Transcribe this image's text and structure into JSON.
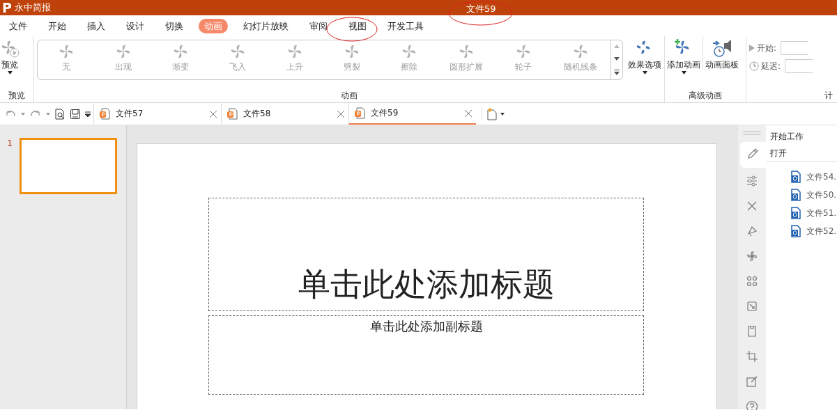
{
  "app": {
    "logo": "P",
    "name": "永中简报",
    "title": "文件59"
  },
  "menu": [
    {
      "label": "文件",
      "selected": false
    },
    {
      "label": "开始",
      "selected": false
    },
    {
      "label": "插入",
      "selected": false
    },
    {
      "label": "设计",
      "selected": false
    },
    {
      "label": "切换",
      "selected": false
    },
    {
      "label": "动画",
      "selected": true
    },
    {
      "label": "幻灯片放映",
      "selected": false
    },
    {
      "label": "审阅",
      "selected": false
    },
    {
      "label": "视图",
      "selected": false
    },
    {
      "label": "开发工具",
      "selected": false
    }
  ],
  "ribbon": {
    "preview": {
      "label": "预览",
      "group": "预览"
    },
    "effects": [
      "无",
      "出现",
      "渐变",
      "飞入",
      "上升",
      "劈裂",
      "擦除",
      "圆形扩展",
      "轮子",
      "随机线条"
    ],
    "animation_group": "动画",
    "effect_options": "效果选项",
    "add_animation": "添加动画",
    "animation_pane": "动画面板",
    "advanced_group": "高级动画",
    "timing": {
      "start_label": "开始:",
      "delay_label": "延迟:",
      "group": "计"
    }
  },
  "doc_tabs": [
    {
      "label": "文件57",
      "selected": false
    },
    {
      "label": "文件58",
      "selected": false
    },
    {
      "label": "文件59",
      "selected": true
    }
  ],
  "slides": [
    {
      "number": "1",
      "selected": true
    }
  ],
  "slide": {
    "title_placeholder": "单击此处添加标题",
    "subtitle_placeholder": "单击此处添加副标题"
  },
  "task_pane": {
    "title": "开始工作",
    "section": "打开",
    "files": [
      "文件54.",
      "文件50.",
      "文件51.",
      "文件52."
    ]
  }
}
